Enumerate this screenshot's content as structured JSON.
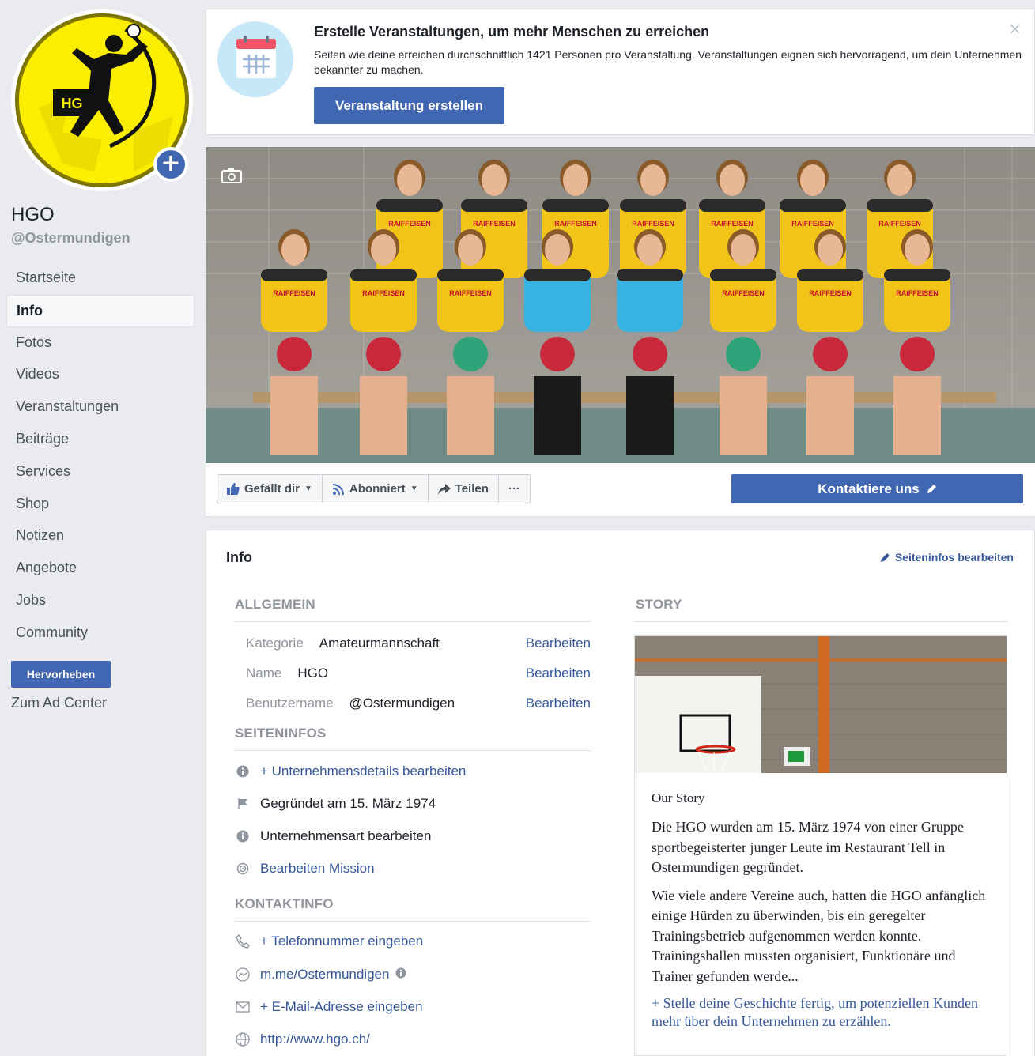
{
  "page": {
    "name": "HGO",
    "handle": "@Ostermundigen"
  },
  "nav": {
    "items": [
      {
        "label": "Startseite"
      },
      {
        "label": "Info"
      },
      {
        "label": "Fotos"
      },
      {
        "label": "Videos"
      },
      {
        "label": "Veranstaltungen"
      },
      {
        "label": "Beiträge"
      },
      {
        "label": "Services"
      },
      {
        "label": "Shop"
      },
      {
        "label": "Notizen"
      },
      {
        "label": "Angebote"
      },
      {
        "label": "Jobs"
      },
      {
        "label": "Community"
      }
    ],
    "active": "Info",
    "promote_label": "Hervorheben",
    "ad_center_label": "Zum Ad Center"
  },
  "event_banner": {
    "title": "Erstelle Veranstaltungen, um mehr Menschen zu erreichen",
    "description": "Seiten wie deine erreichen durchschnittlich 1421 Personen pro Veranstaltung. Veranstaltungen eignen sich hervorragend, um dein Unternehmen bekannter zu machen.",
    "button_label": "Veranstaltung erstellen",
    "close_label": "×"
  },
  "cover": {
    "jersey_text": "RAIFFEISEN"
  },
  "actions": {
    "like_label": "Gefällt dir",
    "follow_label": "Abonniert",
    "share_label": "Teilen",
    "more_label": "···",
    "contact_label": "Kontaktiere uns"
  },
  "info": {
    "title": "Info",
    "edit_page_info_label": "Seiteninfos bearbeiten",
    "general": {
      "heading": "ALLGEMEIN",
      "rows": [
        {
          "label": "Kategorie",
          "value": "Amateurmannschaft",
          "edit": "Bearbeiten"
        },
        {
          "label": "Name",
          "value": "HGO",
          "edit": "Bearbeiten"
        },
        {
          "label": "Benutzername",
          "value": "@Ostermundigen",
          "edit": "Bearbeiten"
        }
      ]
    },
    "page_info": {
      "heading": "SEITENINFOS",
      "items": [
        {
          "icon": "info-icon",
          "text": "+ Unternehmensdetails bearbeiten",
          "link": true
        },
        {
          "icon": "flag-icon",
          "text": "Gegründet am 15. März 1974",
          "link": false
        },
        {
          "icon": "info-icon",
          "text": "Unternehmensart bearbeiten",
          "link": false
        },
        {
          "icon": "mission-icon",
          "text": "Bearbeiten Mission",
          "link": true
        }
      ]
    },
    "contact_info": {
      "heading": "KONTAKTINFO",
      "items": [
        {
          "icon": "phone-icon",
          "text": "+ Telefonnummer eingeben"
        },
        {
          "icon": "messenger-icon",
          "text": "m.me/Ostermundigen"
        },
        {
          "icon": "mail-icon",
          "text": "+ E-Mail-Adresse eingeben"
        },
        {
          "icon": "globe-icon",
          "text": "http://www.hgo.ch/"
        }
      ]
    },
    "story": {
      "heading": "STORY",
      "title": "Our Story",
      "paragraphs": [
        "Die HGO wurden am 15. März 1974 von einer Gruppe sportbegeisterter junger Leute im Restaurant Tell in Ostermundigen gegründet.",
        "Wie viele andere Vereine auch, hatten die HGO anfänglich einige Hürden zu überwinden, bis ein geregelter Trainingsbetrieb aufgenommen werden konnte. Trainingshallen mussten organisiert, Funktionäre und Trainer gefunden werde..."
      ],
      "cta": "+ Stelle deine Geschichte fertig, um potenziellen Kunden mehr über dein Unternehmen zu erzählen."
    }
  },
  "colors": {
    "brand_blue": "#4267b2",
    "link_blue": "#365899",
    "page_bg": "#e9ebee",
    "muted_text": "#90949c",
    "logo_yellow": "#fff200"
  }
}
